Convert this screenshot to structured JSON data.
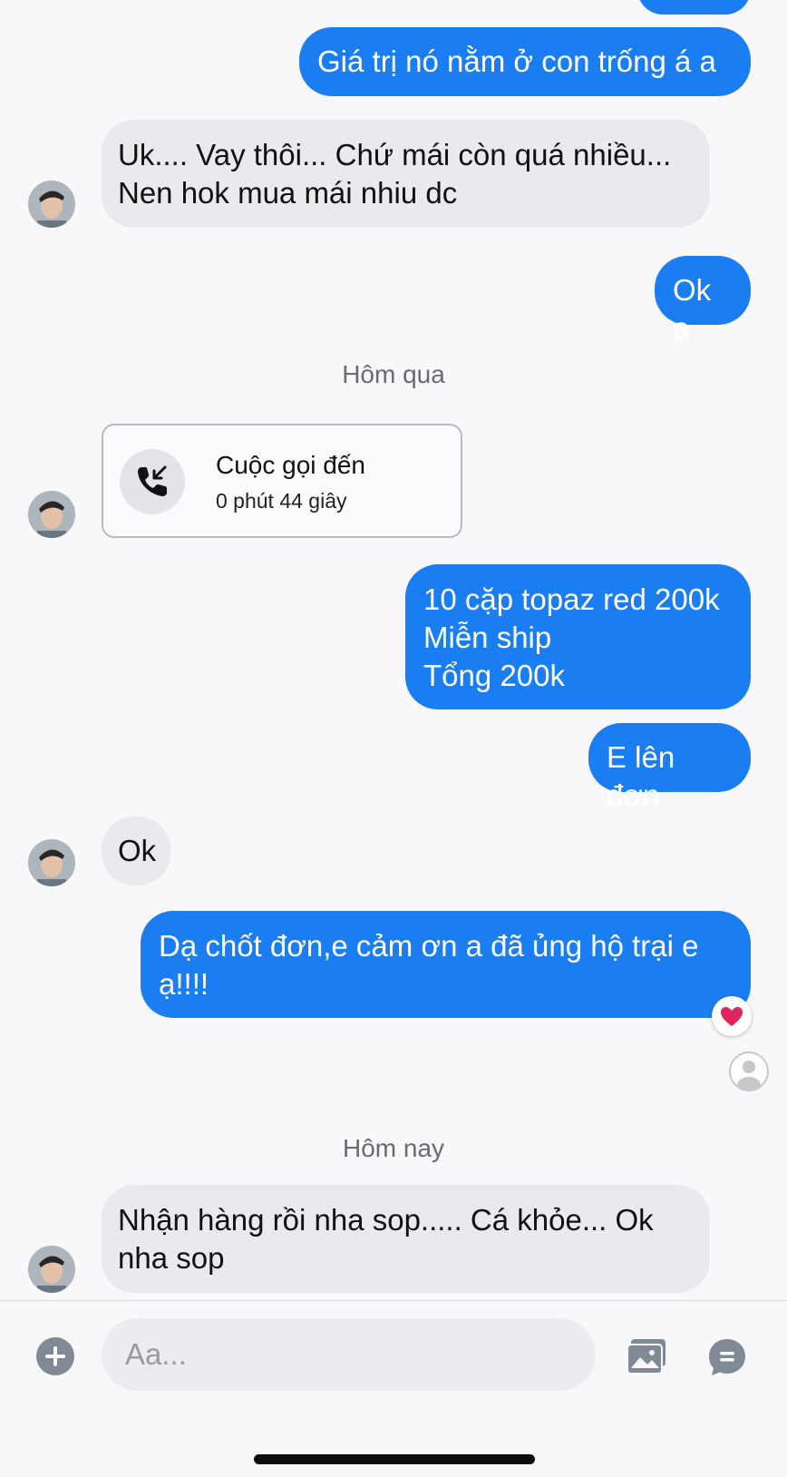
{
  "messages": {
    "m1": "Giá trị nó nằm ở con trống á a",
    "m2": "Uk.... Vay thôi... Chứ mái còn quá nhiều...\nNen hok mua mái nhiu dc",
    "m3": "Ok ạ",
    "call_title": "Cuộc gọi đến",
    "call_duration": "0 phút 44 giây",
    "m4": "10 cặp topaz red 200k\nMiễn ship\nTổng 200k",
    "m5": "E lên đơn",
    "m6": "Ok",
    "m7": "Dạ chốt đơn,e cảm ơn a đã ủng hộ trại e\nạ!!!!",
    "m8": "Nhận hàng rồi nha sop..... Cá khỏe... Ok\nnha sop"
  },
  "separators": {
    "yesterday": "Hôm qua",
    "today": "Hôm nay"
  },
  "composer": {
    "placeholder": "Aa..."
  },
  "colors": {
    "outgoing_bubble": "#1a7ef2",
    "incoming_bubble": "#e9e9ee",
    "reaction": "#e0245e"
  },
  "icons": {
    "add": "plus-circle-icon",
    "gallery": "image-gallery-icon",
    "quick_reply": "chat-bubble-icon",
    "call": "incoming-call-icon",
    "reaction": "heart-icon",
    "seen": "seen-avatar-icon"
  }
}
